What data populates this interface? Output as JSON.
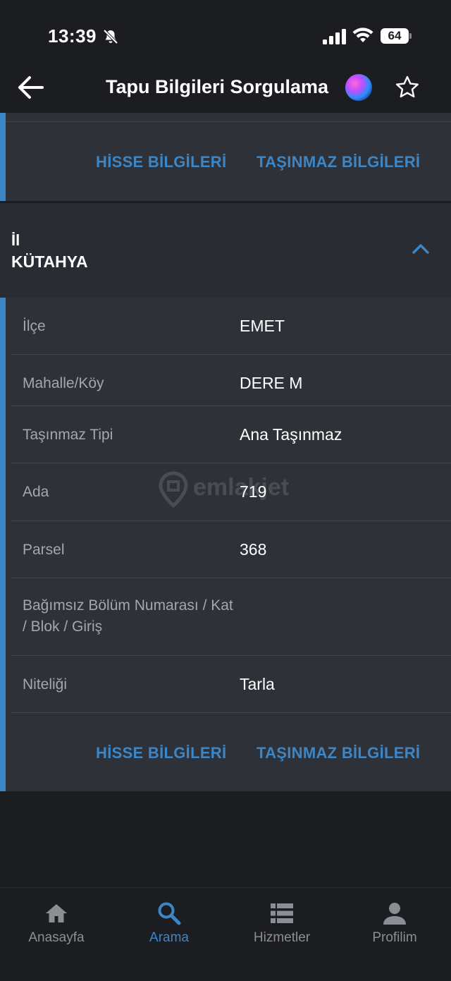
{
  "status_bar": {
    "time": "13:39",
    "battery": "64"
  },
  "header": {
    "title": "Tapu Bilgileri Sorgulama"
  },
  "top_card": {
    "link_shares": "HİSSE BİLGİLERİ",
    "link_property": "TAŞINMAZ BİLGİLERİ"
  },
  "province": {
    "label": "İl",
    "value": "KÜTAHYA"
  },
  "details": {
    "rows": [
      {
        "label": "İlçe",
        "value": "EMET"
      },
      {
        "label": "Mahalle/Köy",
        "value": "DERE M"
      },
      {
        "label": "Taşınmaz Tipi",
        "value": "Ana Taşınmaz"
      },
      {
        "label": "Ada",
        "value": "719"
      },
      {
        "label": "Parsel",
        "value": "368"
      },
      {
        "label": "Bağımsız Bölüm Numarası / Kat / Blok / Giriş",
        "value": ""
      },
      {
        "label": "Niteliği",
        "value": "Tarla"
      }
    ],
    "link_shares": "HİSSE BİLGİLERİ",
    "link_property": "TAŞINMAZ BİLGİLERİ"
  },
  "watermark": "emlakjet",
  "tab_bar": {
    "tabs": [
      {
        "label": "Anasayfa",
        "icon": "home-icon"
      },
      {
        "label": "Arama",
        "icon": "search-icon",
        "active": true
      },
      {
        "label": "Hizmetler",
        "icon": "list-icon"
      },
      {
        "label": "Profilim",
        "icon": "user-icon"
      }
    ]
  },
  "colors": {
    "accent": "#3d86c6",
    "background": "#1c1d21",
    "card": "#2f3139"
  }
}
